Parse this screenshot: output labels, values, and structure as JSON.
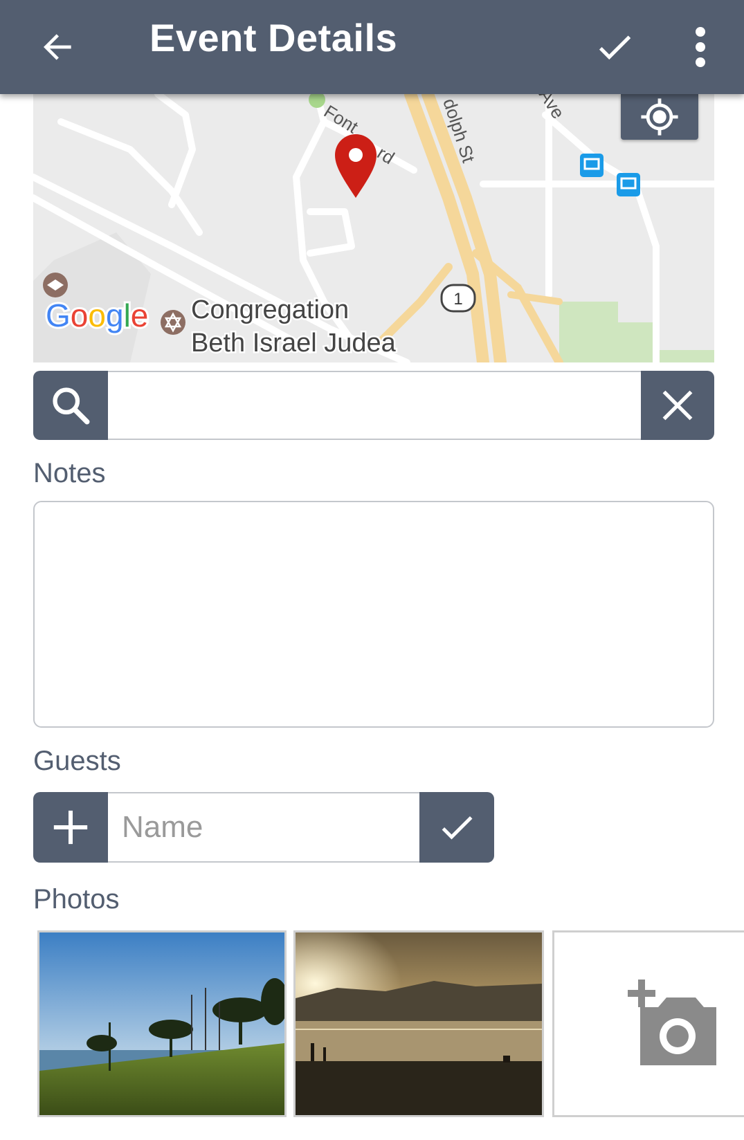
{
  "header": {
    "title": "Event Details",
    "back_icon": "arrow-left-icon",
    "confirm_icon": "check-icon",
    "menu_icon": "more-vert-icon",
    "bg_color": "#535e70"
  },
  "map": {
    "street_labels": [
      "dolph St",
      "Font",
      "rd",
      "Ave"
    ],
    "highway_shield": "1",
    "poi_label_line1": "Congregation",
    "poi_label_line2": "Beth Israel Judea",
    "provider": "Google",
    "marker_color": "#cc1f16",
    "locate_icon": "my-location-icon"
  },
  "search": {
    "value": "",
    "search_icon": "search-icon",
    "clear_icon": "close-icon"
  },
  "notes": {
    "label": "Notes",
    "value": ""
  },
  "guests": {
    "label": "Guests",
    "placeholder": "Name",
    "add_icon": "plus-icon",
    "confirm_icon": "check-icon"
  },
  "photos": {
    "label": "Photos",
    "items": [
      "photo-harbor-trees",
      "photo-sunset-bay"
    ],
    "add_icon": "add-photo-icon"
  }
}
